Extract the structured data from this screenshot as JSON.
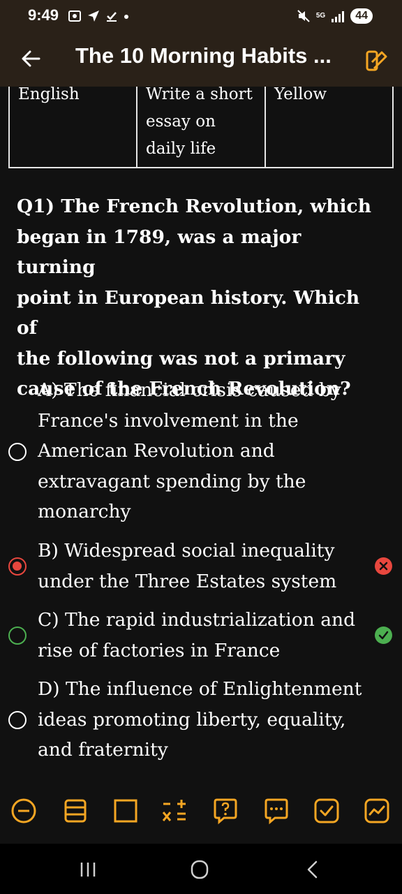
{
  "status_bar": {
    "time": "9:49",
    "network": "5G",
    "battery": "44",
    "left_icons": [
      "screenshot-icon",
      "navigation-arrow-icon",
      "download-check-icon",
      "dot-icon"
    ],
    "right_icons": [
      "mute-icon",
      "signal-icon"
    ]
  },
  "header": {
    "title": "The 10 Morning Habits ...",
    "back_icon": "back-arrow-icon",
    "edit_icon": "edit-icon",
    "background": "#2a2118"
  },
  "table": {
    "row": [
      [
        "English"
      ],
      [
        "Write a short",
        "essay on",
        "daily life"
      ],
      [
        "Yellow"
      ]
    ]
  },
  "question": {
    "lines": [
      "Q1) The French Revolution, which",
      "began in 1789, was a major turning",
      "point in European history. Which of",
      "the following was not a primary",
      "cause of the French Revolution?"
    ]
  },
  "options": [
    {
      "lines": [
        "A) The financial crisis caused by",
        "France's involvement in the",
        "American Revolution and",
        "extravagant spending by the",
        "monarchy"
      ],
      "state": "unselected"
    },
    {
      "lines": [
        "B) Widespread social inequality",
        "under the Three Estates system"
      ],
      "state": "selected-wrong"
    },
    {
      "lines": [
        "C) The rapid industrialization and",
        "rise of factories in France"
      ],
      "state": "correct"
    },
    {
      "lines": [
        "D) The influence of Enlightenment",
        "ideas promoting liberty, equality,",
        "and fraternity"
      ],
      "state": "unselected"
    }
  ],
  "toolbar": {
    "icons": [
      "minus-circle-icon",
      "list-icon",
      "square-icon",
      "plus-minus-icon",
      "question-bubble-icon",
      "more-bubble-icon",
      "check-box-icon",
      "chart-box-icon"
    ],
    "accent": "#f5a623"
  },
  "colors": {
    "wrong": "#e8473e",
    "correct": "#4caf50",
    "accent": "#f5a623"
  },
  "navbar": {
    "icons": [
      "recent-apps-icon",
      "home-icon",
      "back-icon"
    ]
  }
}
